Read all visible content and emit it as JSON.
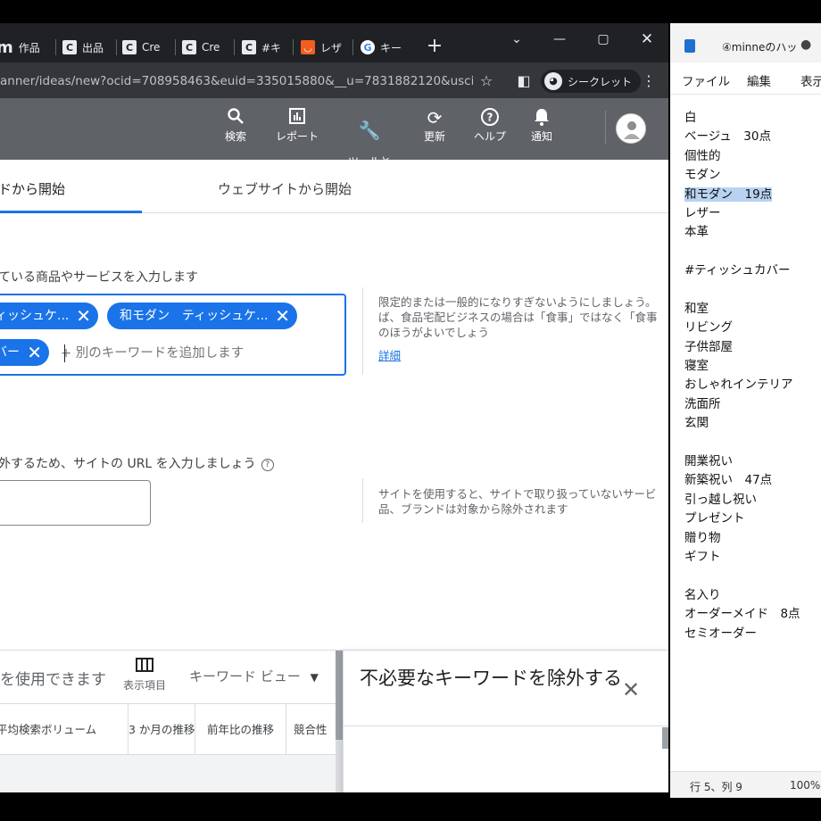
{
  "browser": {
    "tabs": [
      {
        "label": "作品",
        "icon": "m-logo-icon"
      },
      {
        "label": "出品",
        "icon": "c-letter-icon"
      },
      {
        "label": "Cre",
        "icon": "c-letter-icon"
      },
      {
        "label": "Cre",
        "icon": "c-letter-icon"
      },
      {
        "label": "#キ",
        "icon": "c-letter-icon"
      },
      {
        "label": "レザ",
        "icon": "shop-icon"
      },
      {
        "label": "キー",
        "icon": "google-icon"
      }
    ],
    "url": "anner/ideas/new?ocid=708958463&euid=335015880&__u=7831882120&usci...",
    "incognito_label": "シークレット"
  },
  "ads_nav": [
    {
      "label": "検索",
      "icon": "search-icon"
    },
    {
      "label": "レポート",
      "icon": "report-icon"
    },
    {
      "label": "ツールと\n設定",
      "icon": "wrench-icon"
    },
    {
      "label": "更新",
      "icon": "refresh-icon"
    },
    {
      "label": "ヘルプ",
      "icon": "help-icon"
    },
    {
      "label": "通知",
      "icon": "bell-icon"
    }
  ],
  "planner": {
    "tabs": [
      "ドから開始",
      "ウェブサイトから開始"
    ],
    "products_label": "ている商品やサービスを入力します",
    "chips": [
      "ィッシュケ...",
      "和モダン　ティッシュケ...",
      "バー"
    ],
    "keyword_placeholder": "+ 別のキーワードを追加します",
    "help_text_1": [
      "限定的または一般的になりすぎないようにしましょう。",
      "ば、食品宅配ビジネスの場合は「食事」ではなく「食事",
      "のほうがよいでしょう"
    ],
    "help_link": "詳細",
    "url_label": "外するため、サイトの URL を入力しましょう",
    "help_text_2": [
      "サイトを使用すると、サイトで取り扱っていないサービ",
      "品、ブランドは対象から除外されます"
    ]
  },
  "results": {
    "left_text": "を使用できます",
    "columns_button": "表示項目",
    "view_select": "キーワード ビュー",
    "columns": [
      "平均検索ボリューム",
      "3 か月の推移",
      "前年比の推移",
      "競合性"
    ]
  },
  "exclude_panel": {
    "title": "不必要なキーワードを除外する"
  },
  "notepad": {
    "title": "④minneのハッ",
    "menu": [
      "ファイル",
      "編集",
      "表示"
    ],
    "lines": [
      "白",
      "ベージュ　30点",
      "個性的",
      "モダン",
      "和モダン　19点",
      "レザー",
      "本革",
      "",
      "#ティッシュカバー",
      "",
      "和室",
      "リビング",
      "子供部屋",
      "寝室",
      "おしゃれインテリア",
      "洗面所",
      "玄関",
      "",
      "開業祝い",
      "新築祝い　47点",
      "引っ越し祝い",
      "プレゼント",
      "贈り物",
      "ギフト",
      "",
      "名入り",
      "オーダーメイド　8点",
      "セミオーダー"
    ],
    "selected_line": 4,
    "status_position": "行 5、列 9",
    "status_zoom": "100%"
  },
  "colors": {
    "accent": "#1a73e8",
    "ads_header": "#5f6368",
    "chrome_dark": "#202124",
    "selection": "#b8d3f1"
  }
}
